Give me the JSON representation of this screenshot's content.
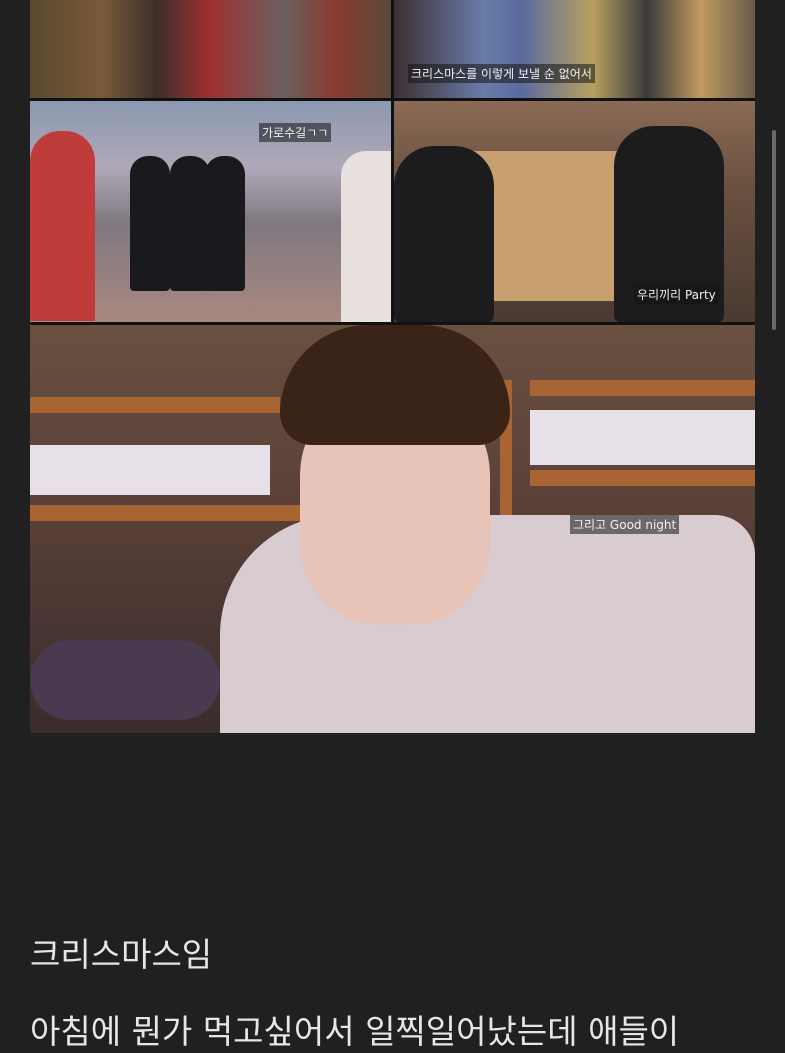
{
  "collage": {
    "captions": {
      "christmas_line": "크리스마스를 이렇게 보낼 순 없어서",
      "street": "가로수길ㄱㄱ",
      "party": "우리끼리 Party",
      "goodnight": "그리고 Good night"
    }
  },
  "article": {
    "heading": "크리스마스임",
    "paragraph_start": "아침에 뭔가 먹고싶어서 일찍일어났는데 애들이"
  }
}
